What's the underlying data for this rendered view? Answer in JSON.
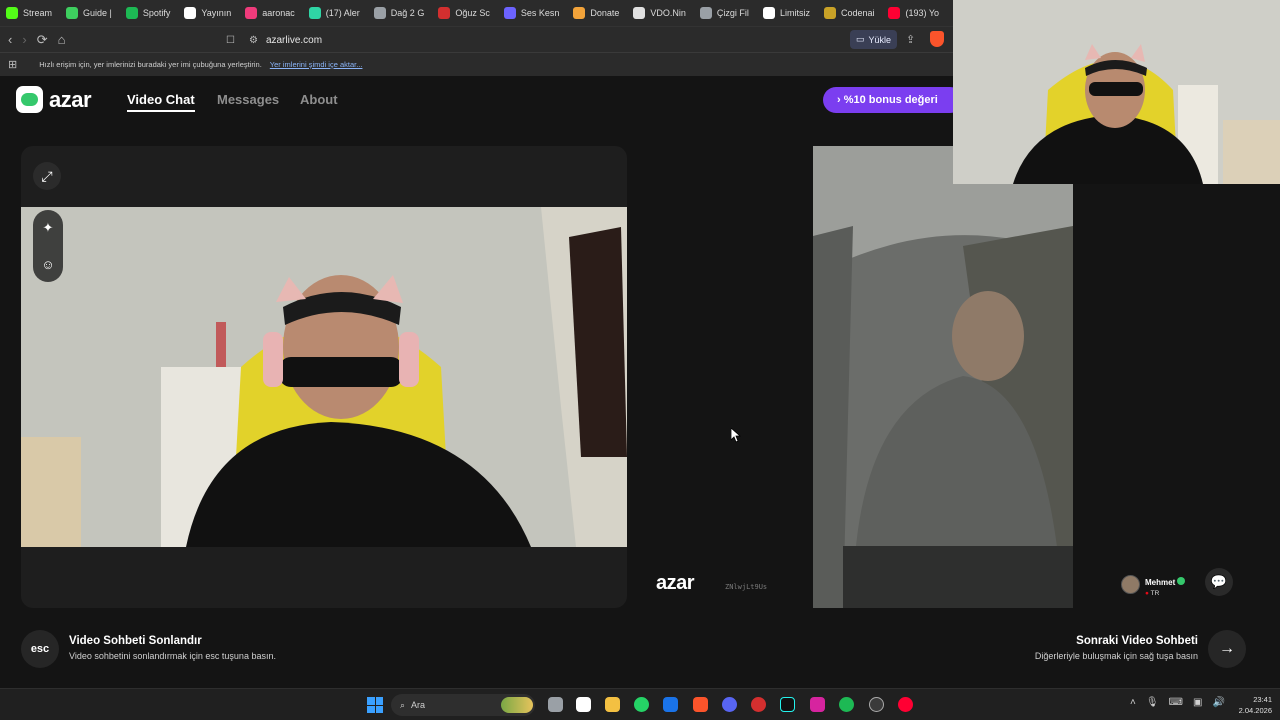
{
  "browser": {
    "bookmarks": [
      {
        "label": "Stream",
        "color": "#53fc18"
      },
      {
        "label": "Guide |",
        "color": "#3ecf5f"
      },
      {
        "label": "Spotify",
        "color": "#1db954"
      },
      {
        "label": "Yayının",
        "color": "#ffffff"
      },
      {
        "label": "aaronac",
        "color": "#ef3b7b"
      },
      {
        "label": "(17) Aler",
        "color": "#2fd5a5"
      },
      {
        "label": "Dağ 2 G",
        "color": "#9aa0a6"
      },
      {
        "label": "Oğuz Sc",
        "color": "#d32f2f"
      },
      {
        "label": "Ses Kesn",
        "color": "#6c63ff"
      },
      {
        "label": "Donate",
        "color": "#f2a33a"
      },
      {
        "label": "VDO.Nin",
        "color": "#e0e0e0"
      },
      {
        "label": "Çizgi Fil",
        "color": "#9aa0a6"
      },
      {
        "label": "Limitsiz",
        "color": "#ffffff"
      },
      {
        "label": "Codenai",
        "color": "#c9a227"
      },
      {
        "label": "(193) Yo",
        "color": "#ff0033"
      }
    ],
    "url": "azarlive.com",
    "upload_label": "Yükle",
    "infobar_text": "Hızlı erişim için, yer imlerinizi buradaki yer imi çubuğuna yerleştirin.",
    "infobar_link": "Yer imlerini şimdi içe aktar..."
  },
  "azar": {
    "logo_text": "azar",
    "tabs": {
      "video_chat": "Video Chat",
      "messages": "Messages",
      "about": "About"
    },
    "bonus_label": "› %10 bonus değeri",
    "watermark": "azar",
    "watermark_id": "ZNlwjLt9Us",
    "peer": {
      "name": "Mehmet",
      "country": "TR"
    },
    "end": {
      "key": "esc",
      "title": "Video Sohbeti Sonlandır",
      "subtitle": "Video sohbetini sonlandırmak için esc tuşuna basın."
    },
    "next": {
      "title": "Sonraki Video Sohbeti",
      "subtitle": "Diğerleriyle buluşmak için sağ tuşa basın"
    }
  },
  "taskbar": {
    "search_placeholder": "Ara",
    "time": "23:41",
    "date": "2.04.2026"
  }
}
